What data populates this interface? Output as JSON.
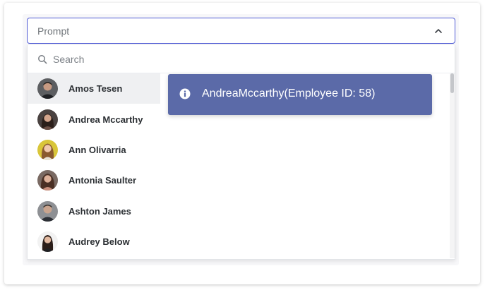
{
  "combobox": {
    "placeholder": "Prompt",
    "expanded": true
  },
  "search": {
    "placeholder": "Search"
  },
  "employees": [
    {
      "name": "Amos Tesen",
      "selected": true
    },
    {
      "name": "Andrea Mccarthy",
      "selected": false
    },
    {
      "name": "Ann Olivarria",
      "selected": false
    },
    {
      "name": "Antonia Saulter",
      "selected": false
    },
    {
      "name": "Ashton James",
      "selected": false
    },
    {
      "name": "Audrey Below",
      "selected": false
    }
  ],
  "toast": {
    "message": "AndreaMccarthy(Employee ID: 58)",
    "icon": "info-icon"
  },
  "colors": {
    "accent": "#4f5bd5",
    "toast_bg": "#5b6aa8"
  }
}
